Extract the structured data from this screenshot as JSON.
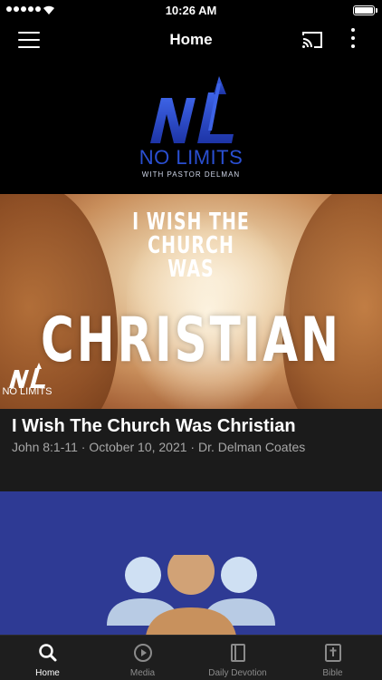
{
  "status_bar": {
    "time": "10:26 AM",
    "signal_bars": 5,
    "battery_level": 1.0
  },
  "nav": {
    "title": "Home",
    "icons": [
      "menu-icon",
      "cast-icon",
      "more-vertical-icon"
    ]
  },
  "banner": {
    "brand": "NO LIMITS",
    "tagline": "WITH PASTOR DELMAN",
    "accent_color": "#2a4fd1"
  },
  "sermon": {
    "artwork_lines": [
      "I WISH THE",
      "CHURCH",
      "WAS",
      "CHRISTIAN"
    ],
    "logo_text": "NO LIMITS",
    "title": "I Wish The Church Was Christian",
    "meta": "John 8:1-11 · October 10, 2021 · Dr. Delman Coates"
  },
  "group_card": {
    "background_color": "#2e3a94",
    "icon": "people-group-icon"
  },
  "tabs": [
    {
      "label": "Home",
      "icon": "search-icon",
      "active": true
    },
    {
      "label": "Media",
      "icon": "play-circle-icon",
      "active": false
    },
    {
      "label": "Daily Devotion",
      "icon": "book-icon",
      "active": false
    },
    {
      "label": "Bible",
      "icon": "bible-cross-icon",
      "active": false
    }
  ]
}
